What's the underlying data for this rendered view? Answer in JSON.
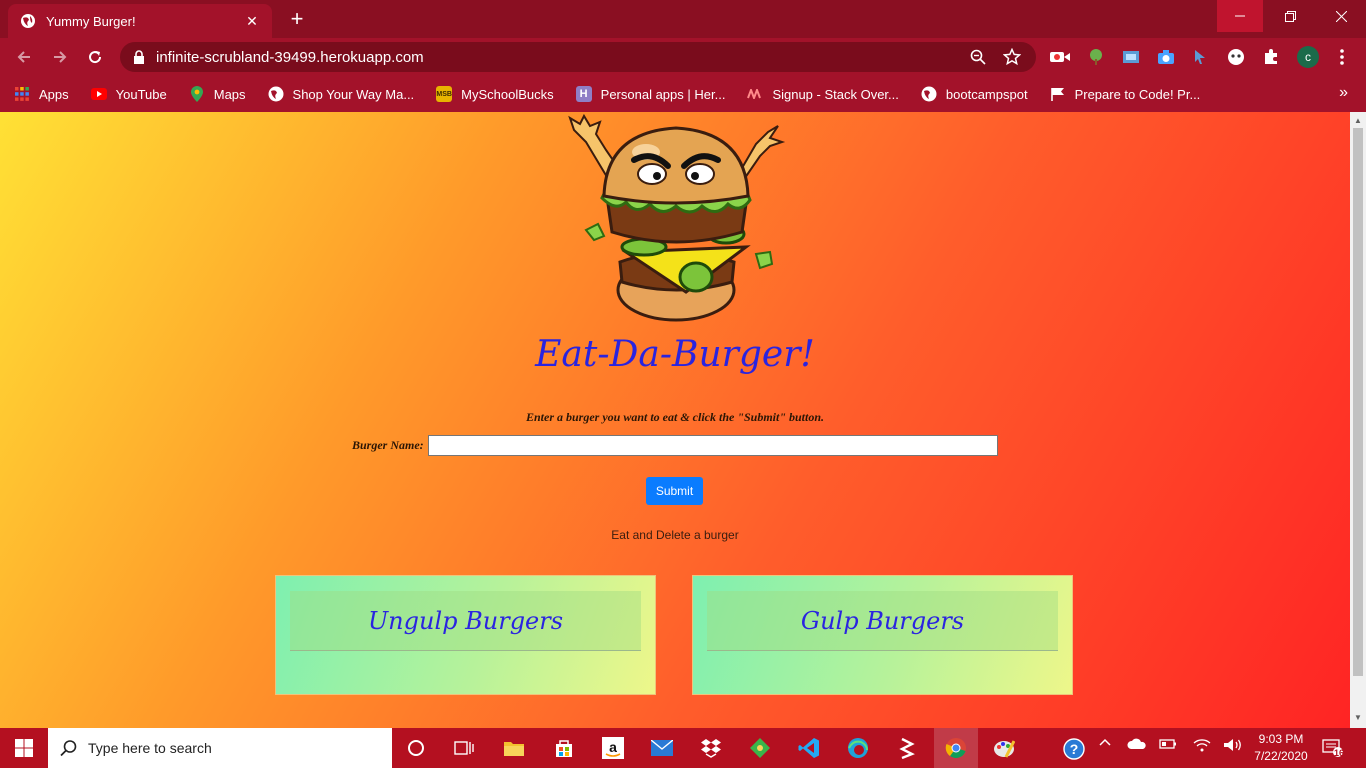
{
  "browser": {
    "tab_title": "Yummy Burger!",
    "tab_close": "✕",
    "new_tab": "+",
    "url": "infinite-scrubland-39499.herokuapp.com",
    "profile_initial": "c",
    "bookmarks": [
      {
        "label": "Apps",
        "icon": "apps-grid-icon"
      },
      {
        "label": "YouTube",
        "icon": "youtube-icon"
      },
      {
        "label": "Maps",
        "icon": "maps-icon"
      },
      {
        "label": "Shop Your Way Ma...",
        "icon": "globe-icon"
      },
      {
        "label": "MySchoolBucks",
        "icon": "myschoolbucks-icon"
      },
      {
        "label": "Personal apps | Her...",
        "icon": "heroku-icon"
      },
      {
        "label": "Signup - Stack Over...",
        "icon": "signup-icon"
      },
      {
        "label": "bootcampspot",
        "icon": "globe-icon"
      },
      {
        "label": "Prepare to Code! Pr...",
        "icon": "flag-icon"
      }
    ],
    "bookmarks_more": "»"
  },
  "page": {
    "headline": "Eat-Da-Burger!",
    "instructions": "Enter a burger you want to eat & click the \"Submit\" button.",
    "burger_name_label": "Burger Name:",
    "burger_name_value": "",
    "submit_label": "Submit",
    "subtitle": "Eat and Delete a burger",
    "cards": {
      "ungulp_title": "Ungulp Burgers",
      "gulp_title": "Gulp Burgers"
    }
  },
  "taskbar": {
    "search_placeholder": "Type here to search",
    "time": "9:03 PM",
    "date": "7/22/2020",
    "notification_count": "16"
  },
  "colors": {
    "chrome_dark": "#8a0f22",
    "chrome": "#a3122a",
    "headline": "#2a24e0",
    "submit": "#0a7cff",
    "taskbar": "#b41020"
  }
}
